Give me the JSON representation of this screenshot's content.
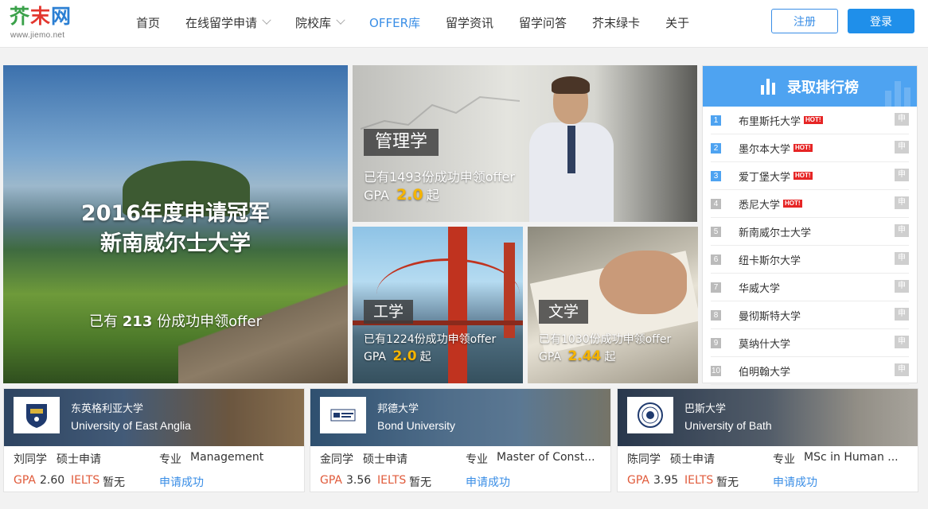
{
  "header": {
    "logo_text": "芥末网",
    "logo_url_text": "www.jiemo.net",
    "nav": [
      {
        "label": "首页",
        "dropdown": false,
        "active": false
      },
      {
        "label": "在线留学申请",
        "dropdown": true,
        "active": false
      },
      {
        "label": "院校库",
        "dropdown": true,
        "active": false
      },
      {
        "label": "OFFER库",
        "dropdown": false,
        "active": true
      },
      {
        "label": "留学资讯",
        "dropdown": false,
        "active": false
      },
      {
        "label": "留学问答",
        "dropdown": false,
        "active": false
      },
      {
        "label": "芥末绿卡",
        "dropdown": false,
        "active": false
      },
      {
        "label": "关于",
        "dropdown": false,
        "active": false
      }
    ],
    "register_label": "注册",
    "login_label": "登录"
  },
  "featured": {
    "title_line1": "2016年度申请冠军",
    "title_line2": "新南威尔士大学",
    "count_prefix": "已有",
    "count": "213",
    "count_suffix": "份成功申领offer"
  },
  "tiles": [
    {
      "tag": "管理学",
      "line": "已有1493份成功申领offer",
      "gpa_label": "GPA",
      "gpa": "2.0",
      "gpa_suffix": "起"
    },
    {
      "tag": "工学",
      "line": "已有1224份成功申领offer",
      "gpa_label": "GPA",
      "gpa": "2.0",
      "gpa_suffix": "起"
    },
    {
      "tag": "文学",
      "line": "已有1030份成功申领offer",
      "gpa_label": "GPA",
      "gpa": "2.44",
      "gpa_suffix": "起"
    }
  ],
  "ranking": {
    "title": "录取排行榜",
    "hot_label": "HOT!",
    "apply_label": "申",
    "items": [
      {
        "rank": "1",
        "name": "布里斯托大学",
        "hot": true
      },
      {
        "rank": "2",
        "name": "墨尔本大学",
        "hot": true
      },
      {
        "rank": "3",
        "name": "爱丁堡大学",
        "hot": true
      },
      {
        "rank": "4",
        "name": "悉尼大学",
        "hot": true
      },
      {
        "rank": "5",
        "name": "新南威尔士大学",
        "hot": false
      },
      {
        "rank": "6",
        "name": "纽卡斯尔大学",
        "hot": false
      },
      {
        "rank": "7",
        "name": "华威大学",
        "hot": false
      },
      {
        "rank": "8",
        "name": "曼彻斯特大学",
        "hot": false
      },
      {
        "rank": "9",
        "name": "莫纳什大学",
        "hot": false
      },
      {
        "rank": "10",
        "name": "伯明翰大学",
        "hot": false
      }
    ]
  },
  "cards": [
    {
      "uni_cn": "东英格利亚大学",
      "uni_en": "University of East Anglia",
      "student": "刘同学",
      "degree": "硕士申请",
      "major_label": "专业",
      "major": "Management",
      "gpa_label": "GPA",
      "gpa": "2.60",
      "ielts_label": "IELTS",
      "ielts": "暂无",
      "status": "申请成功"
    },
    {
      "uni_cn": "邦德大学",
      "uni_en": "Bond University",
      "student": "金同学",
      "degree": "硕士申请",
      "major_label": "专业",
      "major": "Master of Const...",
      "gpa_label": "GPA",
      "gpa": "3.56",
      "ielts_label": "IELTS",
      "ielts": "暂无",
      "status": "申请成功"
    },
    {
      "uni_cn": "巴斯大学",
      "uni_en": "University of Bath",
      "student": "陈同学",
      "degree": "硕士申请",
      "major_label": "专业",
      "major": "MSc in Human ...",
      "gpa_label": "GPA",
      "gpa": "3.95",
      "ielts_label": "IELTS",
      "ielts": "暂无",
      "status": "申请成功"
    }
  ],
  "colors": {
    "accent": "#3a8ee6",
    "rank_header": "#4ea3f1",
    "gpa_highlight": "#f5b400",
    "hot": "#e62525",
    "score_red": "#e05a3a"
  }
}
